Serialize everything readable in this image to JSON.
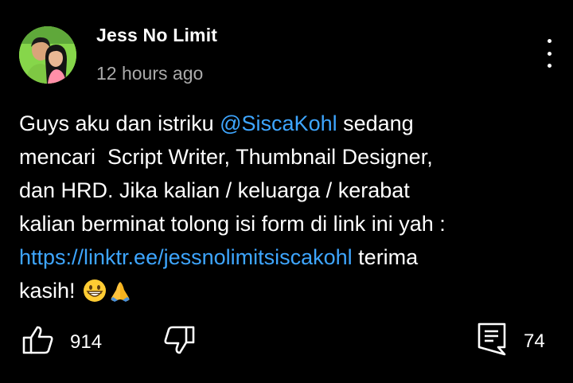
{
  "comment": {
    "author": "Jess No Limit",
    "time": "12 hours ago",
    "text": {
      "line1_before": "Guys aku dan istriku ",
      "mention": "@SiscaKohl",
      "line1_after": " sedang",
      "line2": "mencari  Script Writer, Thumbnail Designer,",
      "line3": "dan HRD. Jika kalian / keluarga / kerabat",
      "line4": "kalian berminat tolong isi form di link ini yah :",
      "link": "https://linktr.ee/jessnolimitsiscakohl",
      "line5_after": " terima",
      "line6": "kasih!"
    },
    "emojis": [
      "grinning-face-emoji",
      "folded-hands-emoji"
    ],
    "likes": "914",
    "replies": "74"
  },
  "icons": {
    "menu": "more-vertical-icon",
    "like": "thumb-up-icon",
    "dislike": "thumb-down-icon",
    "reply": "comment-icon"
  },
  "colors": {
    "background": "#000000",
    "text": "#ffffff",
    "secondary_text": "#aaaaaa",
    "link": "#3ea6ff"
  }
}
